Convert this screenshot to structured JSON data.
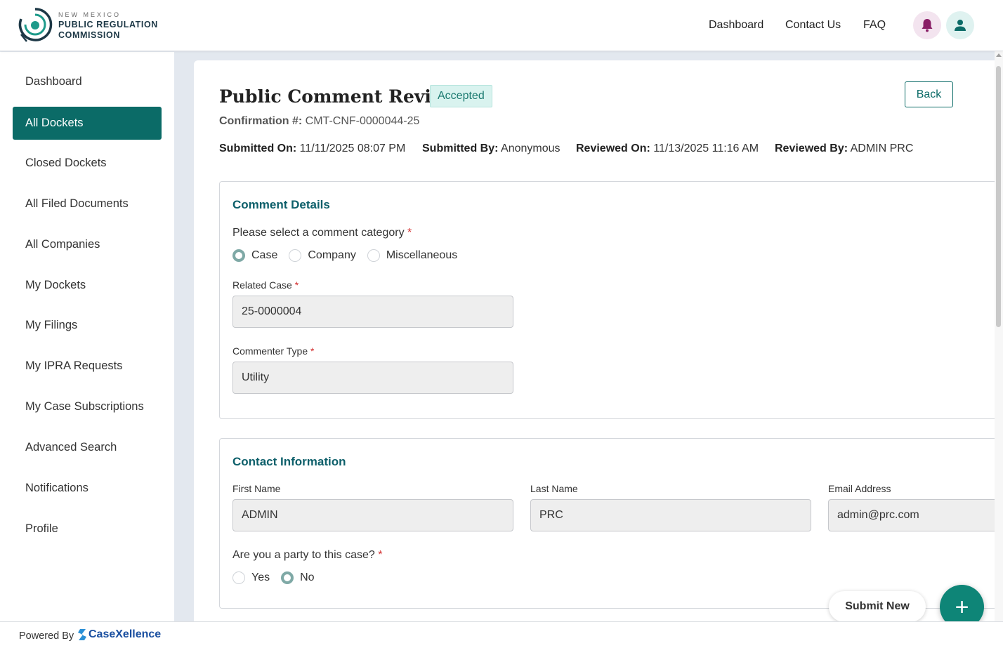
{
  "header": {
    "logo": {
      "line1": "NEW MEXICO",
      "line2": "PUBLIC REGULATION",
      "line3": "COMMISSION"
    },
    "nav": [
      "Dashboard",
      "Contact Us",
      "FAQ"
    ],
    "icons": {
      "notifications": "bell-icon",
      "account": "user-icon"
    }
  },
  "sidebar": {
    "items": [
      {
        "label": "Dashboard",
        "active": false
      },
      {
        "label": "All Dockets",
        "active": true
      },
      {
        "label": "Closed Dockets",
        "active": false
      },
      {
        "label": "All Filed Documents",
        "active": false
      },
      {
        "label": "All Companies",
        "active": false
      },
      {
        "label": "My Dockets",
        "active": false
      },
      {
        "label": "My Filings",
        "active": false
      },
      {
        "label": "My IPRA Requests",
        "active": false
      },
      {
        "label": "My Case Subscriptions",
        "active": false
      },
      {
        "label": "Advanced Search",
        "active": false
      },
      {
        "label": "Notifications",
        "active": false
      },
      {
        "label": "Profile",
        "active": false
      }
    ]
  },
  "page": {
    "title": "Public Comment Review",
    "status": "Accepted",
    "back_label": "Back",
    "confirmation_label": "Confirmation #:",
    "confirmation_value": "CMT-CNF-0000044-25",
    "meta": [
      {
        "label": "Submitted On:",
        "value": "11/11/2025 08:07 PM"
      },
      {
        "label": "Submitted By:",
        "value": "Anonymous"
      },
      {
        "label": "Reviewed On:",
        "value": "11/13/2025 11:16 AM"
      },
      {
        "label": "Reviewed By:",
        "value": "ADMIN PRC"
      }
    ]
  },
  "comment_details": {
    "title": "Comment Details",
    "category_question": "Please select a comment category",
    "category_options": [
      "Case",
      "Company",
      "Miscellaneous"
    ],
    "category_selected": "Case",
    "related_case_label": "Related Case",
    "related_case_value": "25-0000004",
    "commenter_type_label": "Commenter Type",
    "commenter_type_value": "Utility"
  },
  "contact_info": {
    "title": "Contact Information",
    "first_name_label": "First Name",
    "first_name_value": "ADMIN",
    "last_name_label": "Last Name",
    "last_name_value": "PRC",
    "email_label": "Email Address",
    "email_value": "admin@prc.com",
    "party_question": "Are you a party to this case?",
    "party_options": [
      "Yes",
      "No"
    ],
    "party_selected": "No"
  },
  "required_marker": "*",
  "actions": {
    "submit_new_label": "Submit New",
    "fab_symbol": "+"
  },
  "footer": {
    "powered_by": "Powered By",
    "brand": "CaseXellence"
  },
  "colors": {
    "primary": "#0b6b67",
    "accent_title": "#0d5f6a",
    "fab": "#0e8577",
    "badge_bg": "#d9f3ef",
    "required": "#d32f2f"
  }
}
